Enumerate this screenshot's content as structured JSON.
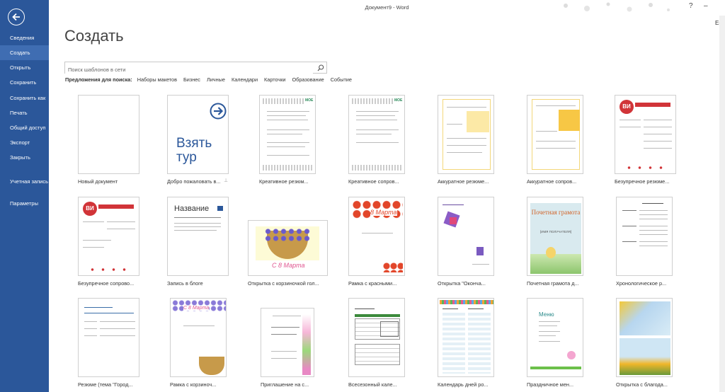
{
  "window": {
    "title": "Документ9 - Word",
    "user": "Екате"
  },
  "sidebar": {
    "items": [
      {
        "label": "Сведения"
      },
      {
        "label": "Создать",
        "active": true
      },
      {
        "label": "Открыть"
      },
      {
        "label": "Сохранить"
      },
      {
        "label": "Сохранить как"
      },
      {
        "label": "Печать"
      },
      {
        "label": "Общий доступ"
      },
      {
        "label": "Экспорт"
      },
      {
        "label": "Закрыть"
      },
      {
        "label": "Учетная запись"
      },
      {
        "label": "Параметры"
      }
    ]
  },
  "main": {
    "title": "Создать",
    "search": {
      "placeholder": "Поиск шаблонов в сети",
      "value": ""
    },
    "suggestions_label": "Предложения для поиска:",
    "suggestions": [
      "Наборы макетов",
      "Бизнес",
      "Личные",
      "Календари",
      "Карточки",
      "Образование",
      "Событие"
    ]
  },
  "templates": [
    {
      "caption": "Новый документ",
      "kind": "blank"
    },
    {
      "caption": "Добро пожаловать в...",
      "kind": "tour",
      "thumb_text": "Взять тур"
    },
    {
      "caption": "Креативное резюм...",
      "kind": "resume1",
      "thumb_text": "МОЕ"
    },
    {
      "caption": "Креативное сопров...",
      "kind": "resume1",
      "thumb_text": "МОЕ"
    },
    {
      "caption": "Аккуратное резюме...",
      "kind": "neat"
    },
    {
      "caption": "Аккуратное сопров...",
      "kind": "neat2"
    },
    {
      "caption": "Безупречное резюме...",
      "kind": "vi",
      "thumb_text": "ВИ"
    },
    {
      "caption": "Безупречное сопрово...",
      "kind": "vi",
      "thumb_text": "ВИ"
    },
    {
      "caption": "Запись в блоге",
      "kind": "blog",
      "thumb_text": "Название"
    },
    {
      "caption": "Открытка с корзиночкой гол...",
      "kind": "basket",
      "thumb_text": "С 8 Марта"
    },
    {
      "caption": "Рамка с красными...",
      "kind": "frame",
      "thumb_text": "8 Марта"
    },
    {
      "caption": "Открытка \"Оконча...",
      "kind": "card"
    },
    {
      "caption": "Почетная грамота д...",
      "kind": "diploma",
      "thumb_text": "Почетная грамота",
      "thumb_sub": "[ИМЯ ПОЛУЧАТЕЛЯ]"
    },
    {
      "caption": "Хронологическое р...",
      "kind": "chrono"
    },
    {
      "caption": "Резюме (тема \"Город...",
      "kind": "city"
    },
    {
      "caption": "Рамка с корзиноч...",
      "kind": "frame2",
      "thumb_text": "С 8 Марта"
    },
    {
      "caption": "Приглашение на с...",
      "kind": "invite"
    },
    {
      "caption": "Всесезонный кале...",
      "kind": "calendar"
    },
    {
      "caption": "Календарь дней ро...",
      "kind": "bday"
    },
    {
      "caption": "Праздничное мен...",
      "kind": "menu",
      "thumb_text": "Меню"
    },
    {
      "caption": "Открытка с благода...",
      "kind": "thanks"
    }
  ],
  "colors": {
    "sidebar": "#2b579a",
    "active": "#3f6db2",
    "accent_red": "#d13438"
  }
}
